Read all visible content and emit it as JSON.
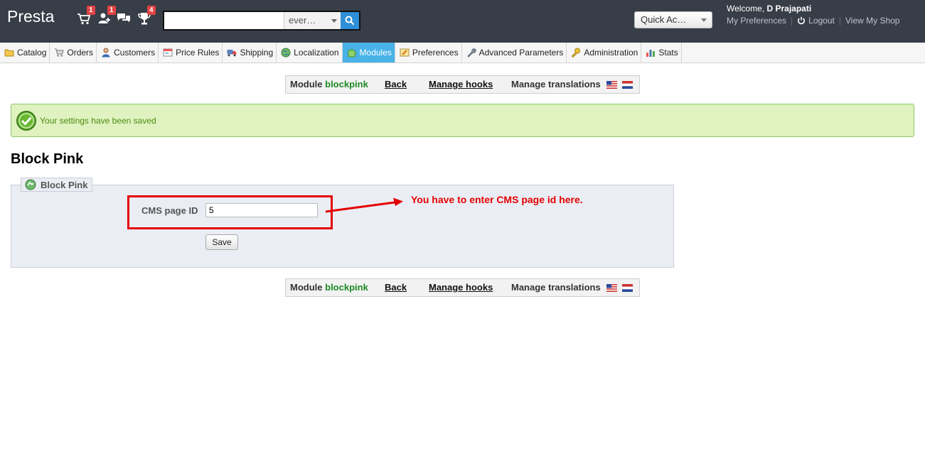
{
  "header": {
    "brand": "Presta",
    "notifications": {
      "orders_count": "1",
      "customers_count": "1",
      "trophy_count": "4"
    },
    "search": {
      "value": "",
      "scope": "ever…"
    },
    "quick_access": "Quick Ac…",
    "welcome_prefix": "Welcome,",
    "user_name": "D Prajapati",
    "links": {
      "preferences": "My Preferences",
      "logout": "Logout",
      "view_shop": "View My Shop"
    }
  },
  "tabs": [
    {
      "label": "Catalog",
      "icon": "folder-icon"
    },
    {
      "label": "Orders",
      "icon": "cart-icon"
    },
    {
      "label": "Customers",
      "icon": "person-icon"
    },
    {
      "label": "Price Rules",
      "icon": "price-tag-icon"
    },
    {
      "label": "Shipping",
      "icon": "truck-icon"
    },
    {
      "label": "Localization",
      "icon": "globe-icon"
    },
    {
      "label": "Modules",
      "icon": "puzzle-icon",
      "active": true
    },
    {
      "label": "Preferences",
      "icon": "settings-icon"
    },
    {
      "label": "Advanced Parameters",
      "icon": "wrench-icon"
    },
    {
      "label": "Administration",
      "icon": "key-icon"
    },
    {
      "label": "Stats",
      "icon": "bar-chart-icon"
    }
  ],
  "module_toolbar": {
    "module_label": "Module",
    "module_name": "blockpink",
    "back": "Back",
    "manage_hooks": "Manage hooks",
    "manage_translations": "Manage translations"
  },
  "success_message": "Your settings have been saved",
  "page_title": "Block Pink",
  "form": {
    "legend": "Block Pink",
    "field_label": "CMS page ID",
    "field_value": "5",
    "save_label": "Save"
  },
  "annotation": "You have to enter CMS page id here.",
  "colors": {
    "header_bg": "#383e48",
    "active_tab": "#49b2e8",
    "module_name": "#1c8a24",
    "success_bg": "#dff2bf",
    "annotation": "#e30000"
  }
}
